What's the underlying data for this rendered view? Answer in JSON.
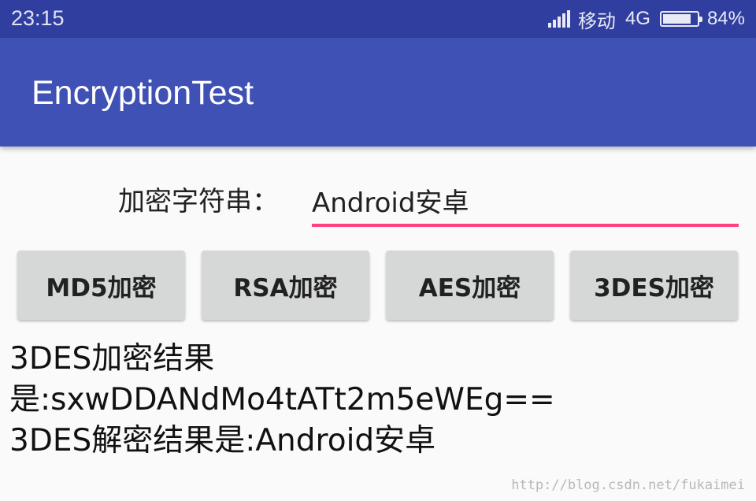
{
  "status_bar": {
    "time": "23:15",
    "carrier": "移动",
    "network": "4G",
    "battery_percent": "84%",
    "battery_level": 0.84,
    "signal_icon": "signal-bars-icon",
    "battery_icon": "battery-icon"
  },
  "app_bar": {
    "title": "EncryptionTest",
    "color": "#3f51b5"
  },
  "form": {
    "label": "加密字符串：",
    "input_value": "Android安卓",
    "underline_color": "#ff4081"
  },
  "buttons": [
    {
      "label": "MD5加密"
    },
    {
      "label": "RSA加密"
    },
    {
      "label": "AES加密"
    },
    {
      "label": "3DES加密"
    }
  ],
  "result": {
    "line1": "3DES加密结果",
    "line2": "是:sxwDDANdMo4tATt2m5eWEg==",
    "line3": "3DES解密结果是:Android安卓"
  },
  "watermark": "http://blog.csdn.net/fukaimei"
}
